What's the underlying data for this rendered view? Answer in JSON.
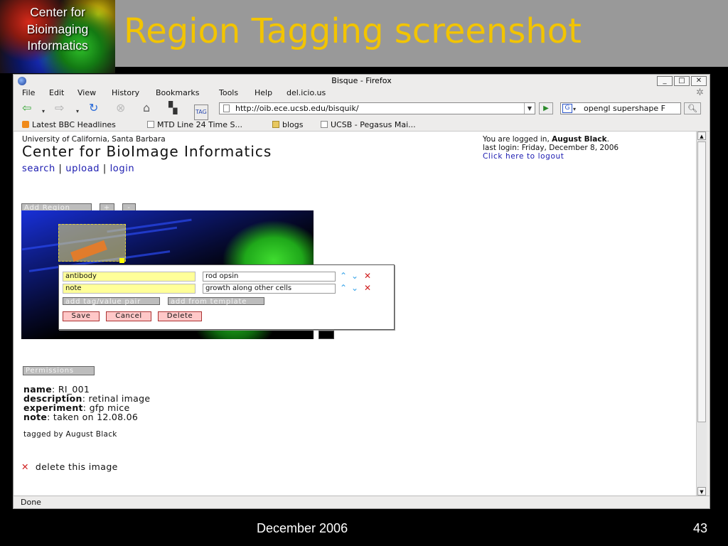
{
  "slide": {
    "logo_lines": [
      "Center for",
      "Bioimaging",
      "Informatics"
    ],
    "title": "Region Tagging screenshot",
    "footer_date": "December 2006",
    "page_number": "43",
    "title_color": "#f2c400"
  },
  "browser": {
    "window_title": "Bisque - Firefox",
    "window_buttons": [
      "_",
      "□",
      "✕"
    ],
    "menu": [
      "File",
      "Edit",
      "View",
      "History",
      "Bookmarks",
      "Tools",
      "Help",
      "del.icio.us"
    ],
    "url": "http://oib.ece.ucsb.edu/bisquik/",
    "search_text": "opengl supershape F",
    "bookmarks": [
      "Latest BBC Headlines",
      "MTD Line 24 Time S...",
      "blogs",
      "UCSB - Pegasus Mai..."
    ],
    "status": "Done"
  },
  "page": {
    "university": "University of California, Santa Barbara",
    "site_title": "Center for BioImage Informatics",
    "nav": {
      "search": "search",
      "upload": "upload",
      "login": "login",
      "sep": "|"
    },
    "login_info": {
      "prefix": "You are logged in, ",
      "user": "August Black",
      "suffix": ".",
      "last_login": "last login: Friday, December 8, 2006",
      "logout": "Click here to logout"
    },
    "add_region": "Add Region",
    "zoom_in": "+",
    "zoom_out": "-",
    "tags": [
      {
        "name": "antibody",
        "value": "rod opsin"
      },
      {
        "name": "note",
        "value": "growth along other cells"
      }
    ],
    "add_pair": "add tag/value pair",
    "add_template": "add from template",
    "save": "Save",
    "cancel": "Cancel",
    "delete": "Delete",
    "permissions": "Permissions",
    "meta": [
      {
        "key": "name",
        "value": ": RI_001"
      },
      {
        "key": "description",
        "value": ": retinal image"
      },
      {
        "key": "experiment",
        "value": ": gfp mice"
      },
      {
        "key": "note",
        "value": ": taken on 12.08.06"
      }
    ],
    "tagged_by": "tagged by August Black",
    "delete_image": "delete this image"
  }
}
